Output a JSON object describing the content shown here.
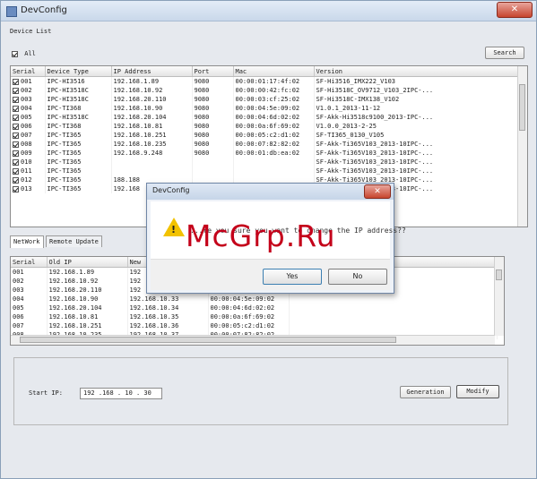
{
  "window": {
    "title": "DevConfig",
    "close_glyph": "✕"
  },
  "device_list": {
    "section_label": "Device List",
    "all_label": "All",
    "search_label": "Search",
    "columns": [
      "Serial",
      "Device Type",
      "IP Address",
      "Port",
      "Mac",
      "Version"
    ],
    "rows": [
      [
        "001",
        "IPC-HI3516",
        "192.168.1.89",
        "9080",
        "00:00:01:17:4f:02",
        "SF-Hi3516_IMX222_V103"
      ],
      [
        "002",
        "IPC-HI3518C",
        "192.168.10.92",
        "9080",
        "00:00:00:42:fc:02",
        "SF-Hi3518C_OV9712_V103_2IPC-..."
      ],
      [
        "003",
        "IPC-HI3518C",
        "192.168.20.110",
        "9080",
        "00:00:03:cf:25:02",
        "SF-Hi3518C-IMX138_V102"
      ],
      [
        "004",
        "IPC-TI368",
        "192.168.10.90",
        "9080",
        "00:00:04:5e:09:02",
        "V1.0.1_2013-11-12"
      ],
      [
        "005",
        "IPC-HI3518C",
        "192.168.20.104",
        "9080",
        "00:00:04:6d:02:02",
        "SF-Akk-Hi3518c9100_2013-IPC-..."
      ],
      [
        "006",
        "IPC-TI368",
        "192.168.10.81",
        "9080",
        "00:00:0a:6f:69:02",
        "V1.0.0_2013-2-25"
      ],
      [
        "007",
        "IPC-TI365",
        "192.168.10.251",
        "9080",
        "00:00:05:c2:d1:02",
        "SF-TI365_0130_V105"
      ],
      [
        "008",
        "IPC-TI365",
        "192.168.10.235",
        "9080",
        "00:00:07:82:82:02",
        "SF-Akk-Ti365V103_2013-10IPC-..."
      ],
      [
        "009",
        "IPC-TI365",
        "192.168.9.248",
        "9080",
        "00:00:01:db:ea:02",
        "SF-Akk-Ti365V103_2013-10IPC-..."
      ],
      [
        "010",
        "IPC-TI365",
        "",
        "",
        "",
        "SF-Akk-Ti365V103_2013-10IPC-..."
      ],
      [
        "011",
        "IPC-TI365",
        "",
        "",
        "",
        "SF-Akk-Ti365V103_2013-10IPC-..."
      ],
      [
        "012",
        "IPC-TI365",
        "188.188",
        "",
        "",
        "SF-Akk-Ti365V103_2013-10IPC-..."
      ],
      [
        "013",
        "IPC-TI365",
        "192.168",
        "",
        "",
        "SF-Akk-Ti365V103_2013-10IPC-..."
      ]
    ]
  },
  "tabs": [
    "NetWork",
    "Remote Update"
  ],
  "network": {
    "columns": [
      "Serial",
      "Old IP",
      "New",
      "",
      ""
    ],
    "rows": [
      [
        "001",
        "192.168.1.89",
        "192",
        "",
        ""
      ],
      [
        "002",
        "192.168.10.92",
        "192",
        "",
        ""
      ],
      [
        "003",
        "192.168.20.110",
        "192",
        "",
        ""
      ],
      [
        "004",
        "192.168.10.90",
        "192.168.10.33",
        "00:00:04:5e:09:02",
        ""
      ],
      [
        "005",
        "192.168.20.104",
        "192.168.10.34",
        "00:00:04:6d:02:02",
        ""
      ],
      [
        "006",
        "192.168.10.81",
        "192.168.10.35",
        "00:00:0a:6f:69:02",
        ""
      ],
      [
        "007",
        "192.168.10.251",
        "192.168.10.36",
        "00:00:05:c2:d1:02",
        ""
      ],
      [
        "008",
        "192.168.10.235",
        "192.168.10.37",
        "00:00:07:82:82:02",
        ""
      ]
    ],
    "start_ip_label": "Start IP:",
    "start_ip_value": "192 .168 . 10 . 30",
    "generation_label": "Generation",
    "modify_label": "Modify"
  },
  "dialog": {
    "title": "DevConfig",
    "close_glyph": "✕",
    "warning_mark": "!",
    "message": "...re you sure you want to change the IP address??",
    "yes_label": "Yes",
    "no_label": "No"
  },
  "watermark": "McGrp.Ru",
  "colors": {
    "warning": "#f2c200",
    "close": "#c7452f",
    "watermark": "#c4001a"
  }
}
